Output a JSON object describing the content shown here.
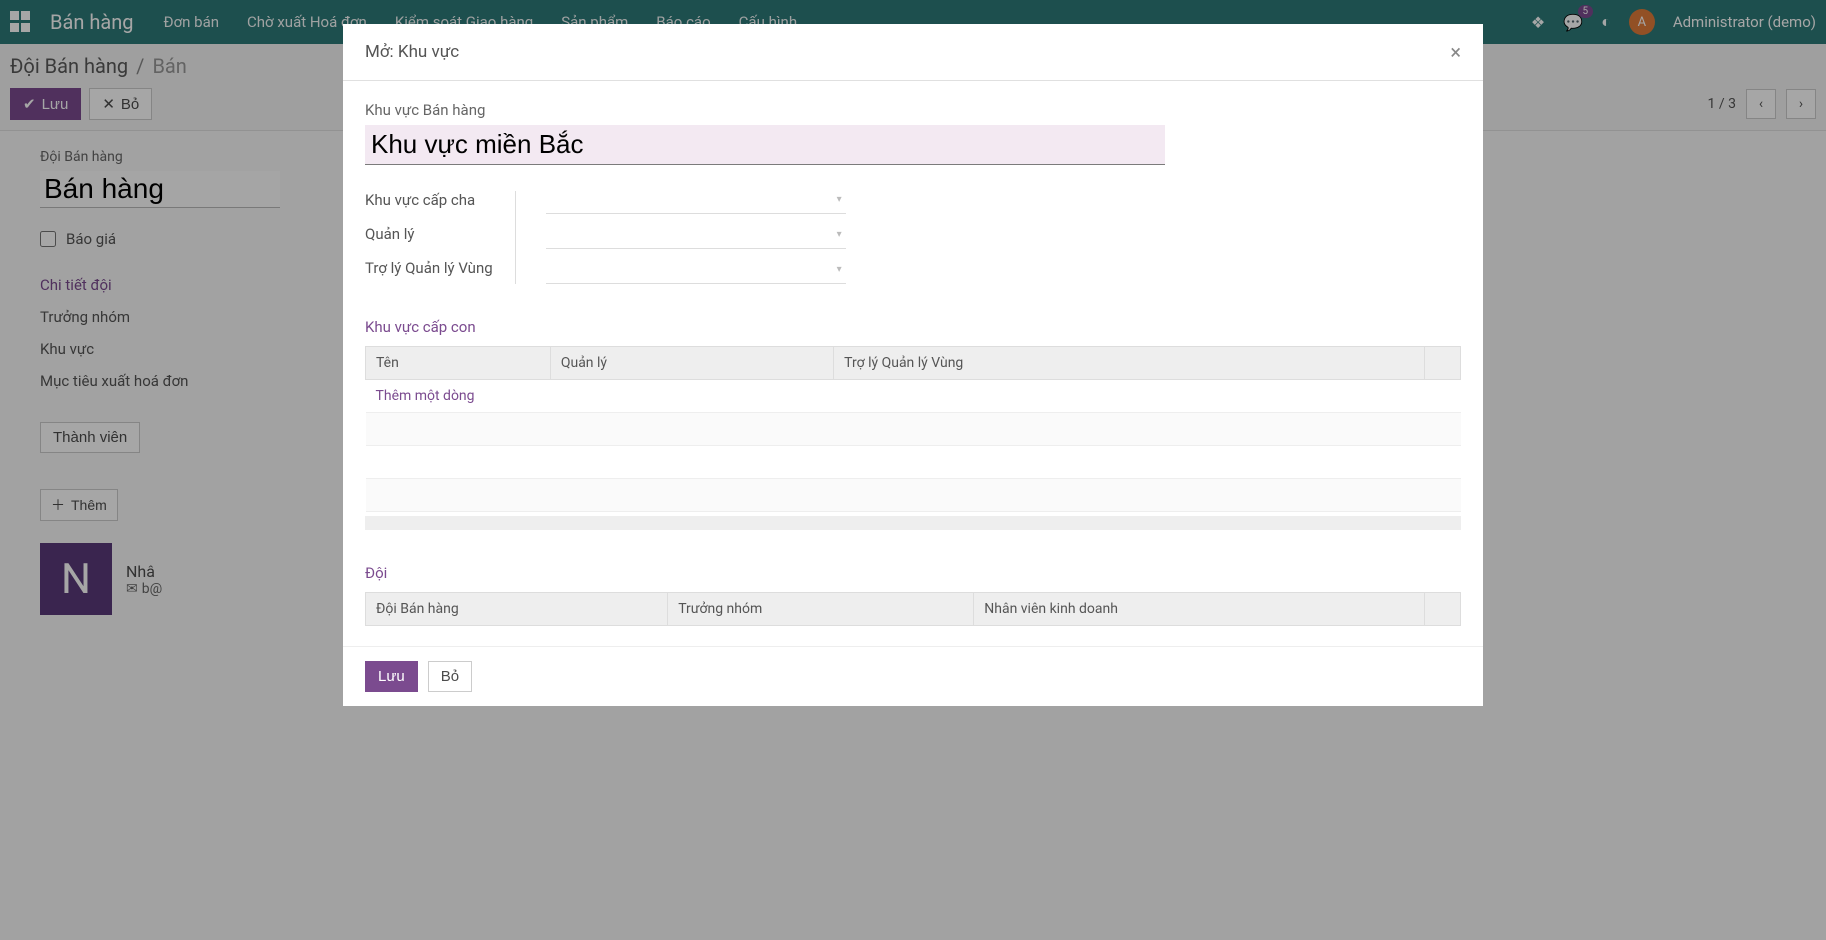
{
  "topbar": {
    "brand": "Bán hàng",
    "menu": [
      "Đơn bán",
      "Chờ xuất Hoá đơn",
      "Kiểm soát Giao hàng",
      "Sản phẩm",
      "Báo cáo",
      "Cấu hình"
    ],
    "notif_count": "5",
    "avatar_letter": "A",
    "user": "Administrator (demo)"
  },
  "breadcrumb": {
    "root": "Đội Bán hàng",
    "current": "Bán"
  },
  "toolbar": {
    "save": "Lưu",
    "discard": "Bỏ",
    "pager": "1 / 3"
  },
  "form": {
    "team_label": "Đội Bán hàng",
    "team_value": "Bán hàng",
    "quote_label": "Báo giá",
    "section_detail": "Chi tiết đội",
    "leader_label": "Trưởng nhóm",
    "region_label": "Khu vực",
    "invoice_target_label": "Mục tiêu xuất hoá đơn",
    "members_header": "Thành viên",
    "add_btn": "Thêm",
    "member_initial": "N",
    "member_name": "Nhâ",
    "member_email": "b@"
  },
  "modal": {
    "title": "Mở: Khu vực",
    "region_label": "Khu vực Bán hàng",
    "region_value": "Khu vực miền Bắc",
    "parent_label": "Khu vực cấp cha",
    "manager_label": "Quản lý",
    "assistant_label": "Trợ lý Quản lý Vùng",
    "children_header": "Khu vực cấp con",
    "col_name": "Tên",
    "col_manager": "Quản lý",
    "col_assistant": "Trợ lý Quản lý Vùng",
    "add_line": "Thêm một dòng",
    "team_header": "Đội",
    "col_team": "Đội Bán hàng",
    "col_leader": "Trưởng nhóm",
    "col_salesperson": "Nhân viên kinh doanh",
    "save_btn": "Lưu",
    "discard_btn": "Bỏ"
  }
}
